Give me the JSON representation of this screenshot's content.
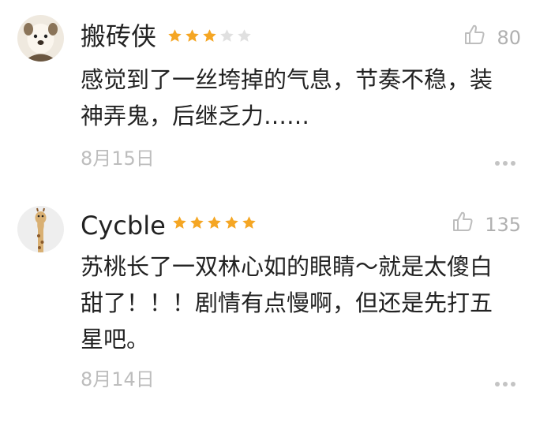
{
  "colors": {
    "star_filled": "#f5a623",
    "star_empty": "#e0e0e0",
    "muted": "#b0b0b0",
    "text": "#222222"
  },
  "reviews": [
    {
      "avatar_icon": "dog-avatar-icon",
      "username": "搬砖侠",
      "rating": 3,
      "rating_max": 5,
      "likes": "80",
      "content": "感觉到了一丝垮掉的气息，节奏不稳，装神弄鬼，后继乏力……",
      "date": "8月15日"
    },
    {
      "avatar_icon": "giraffe-avatar-icon",
      "username": "Cycble",
      "rating": 5,
      "rating_max": 5,
      "likes": "135",
      "content": "苏桃长了一双林心如的眼睛～就是太傻白甜了！！！剧情有点慢啊，但还是先打五星吧。",
      "date": "8月14日"
    }
  ]
}
